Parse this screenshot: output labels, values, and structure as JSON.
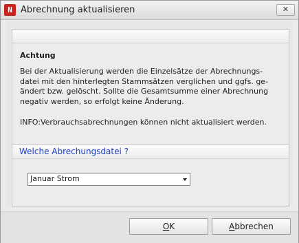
{
  "window": {
    "title": "Abrechnung aktualisieren",
    "icon_name": "app-logo-icon",
    "close_symbol": "✕"
  },
  "info_panel": {
    "heading": "Achtung",
    "body_lines": [
      "Bei der Aktualisierung werden die Einzelsätze der Abrechnungs-",
      "datei mit den hinterlegten Stammsätzen verglichen und ggfs. ge-",
      "ändert bzw. gelöscht. Sollte die Gesamtsumme einer Abrechnung",
      "negativ werden, so erfolgt keine Änderung."
    ],
    "note": "INFO:Verbrauchsabrechnungen können nicht aktualisiert werden."
  },
  "select_panel": {
    "label": "Welche Abrechungsdatei  ?",
    "selected_value": "Januar Strom"
  },
  "buttons": {
    "ok_mnemonic": "O",
    "ok_rest": "K",
    "cancel_mnemonic": "A",
    "cancel_rest": "bbrechen"
  },
  "colors": {
    "label_blue": "#1a3fc4",
    "icon_red": "#c8231f"
  }
}
